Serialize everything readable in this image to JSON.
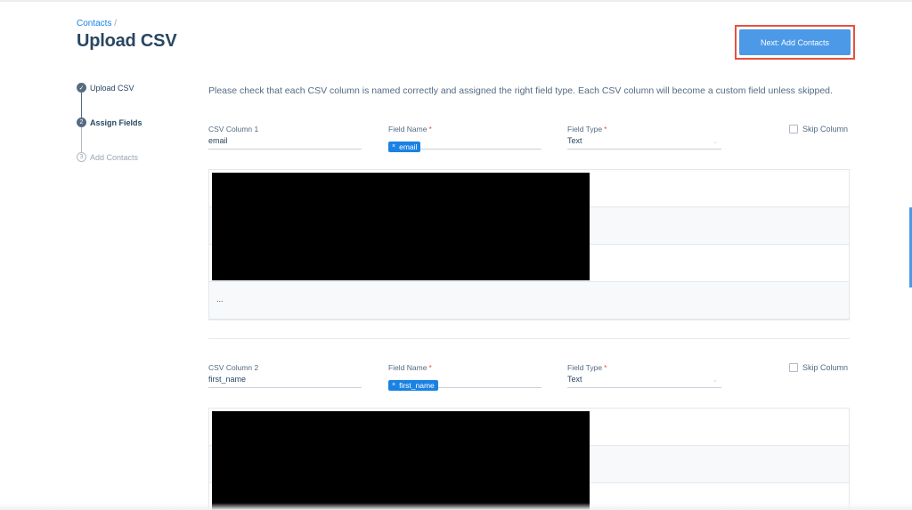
{
  "header": {
    "breadcrumb_link": "Contacts",
    "breadcrumb_separator": "/",
    "title": "Upload CSV",
    "next_button": "Next: Add Contacts"
  },
  "steps": [
    {
      "label": "Upload CSV",
      "marker": "✓",
      "state": "done"
    },
    {
      "label": "Assign Fields",
      "marker": "2",
      "state": "active"
    },
    {
      "label": "Add Contacts",
      "marker": "3",
      "state": "pending"
    }
  ],
  "intro": "Please check that each CSV column is named correctly and assigned the right field type. Each CSV column will become a custom field unless skipped.",
  "columns": [
    {
      "csv_label": "CSV Column 1",
      "csv_value": "email",
      "field_name_label": "Field Name",
      "field_name_value": "email",
      "field_type_label": "Field Type",
      "field_type_value": "Text",
      "skip_label": "Skip Column",
      "preview_ellipsis": "..."
    },
    {
      "csv_label": "CSV Column 2",
      "csv_value": "first_name",
      "field_name_label": "Field Name",
      "field_name_value": "first_name",
      "field_type_label": "Field Type",
      "field_type_value": "Text",
      "skip_label": "Skip Column"
    }
  ],
  "icons": {
    "chip_remove": "×",
    "dropdown": "⌄",
    "required": "*"
  },
  "colors": {
    "accent": "#1a82e2",
    "button": "#4c99e7",
    "highlight": "#e8513a",
    "text": "#294661"
  }
}
